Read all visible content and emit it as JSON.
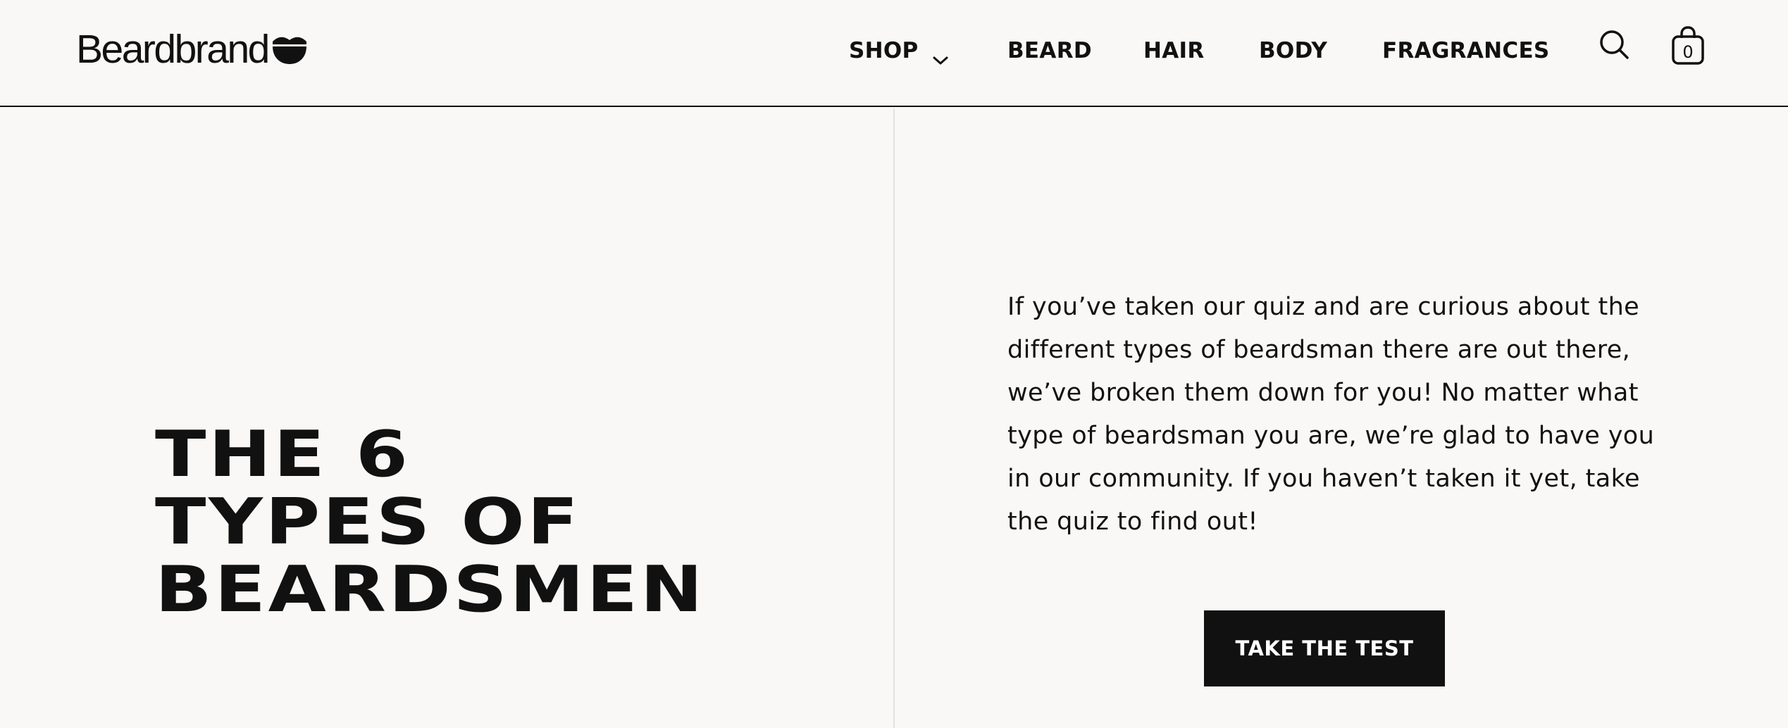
{
  "header": {
    "logo_text": "Beardbrand",
    "nav": {
      "shop": "SHOP",
      "beard": "BEARD",
      "hair": "HAIR",
      "body": "BODY",
      "fragrances": "FRAGRANCES"
    },
    "cart_count": "0"
  },
  "main": {
    "title": "THE 6\nTYPES OF\nBEARDSMEN",
    "intro": "If you’ve taken our quiz and are curious about the different types of beardsman there are out there, we’ve broken them down for you! No matter what type of beardsman you are, we’re glad to have you in our community. If you haven’t taken it yet, take the quiz to find out!",
    "cta_label": "TAKE THE TEST"
  },
  "icons": {
    "logo_mark": "beard-icon",
    "shop_dropdown": "chevron-down-icon",
    "search": "search-icon",
    "cart": "shopping-bag-icon"
  },
  "colors": {
    "background": "#f9f8f6",
    "text": "#111111",
    "button_bg": "#111111",
    "button_text": "#ffffff",
    "divider": "#e4e2de"
  }
}
